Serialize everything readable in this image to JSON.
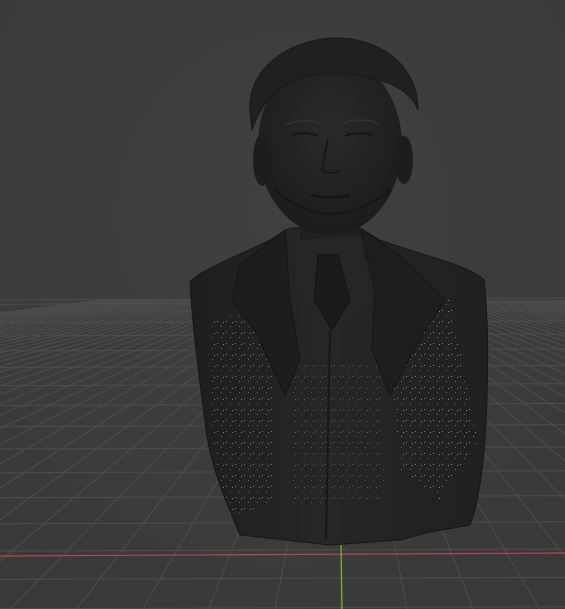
{
  "viewport": {
    "background_color": "#3d3d3d",
    "grid_line_color": "#4d4d4d",
    "x_axis_color": "#b8454f",
    "y_axis_color": "#7bb32f",
    "model": {
      "subject": "bust-sculpture",
      "base_color": "#232323",
      "shade_color": "#1a1a1a",
      "highlight_color": "#d8d8d8"
    }
  }
}
